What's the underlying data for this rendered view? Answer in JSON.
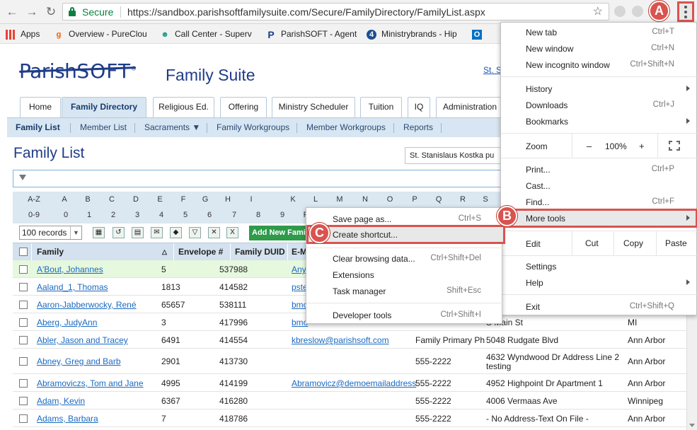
{
  "browser": {
    "secure_label": "Secure",
    "url": "https://sandbox.parishsoftfamilysuite.com/Secure/FamilyDirectory/FamilyList.aspx",
    "bookmarks": [
      {
        "label": "Apps",
        "icon": "apps-grid-icon"
      },
      {
        "label": "Overview - PureClou",
        "icon": "genesys-icon"
      },
      {
        "label": "Call Center - Superv",
        "icon": "person-icon"
      },
      {
        "label": "ParishSOFT - Agent",
        "icon": "parishsoft-p-icon"
      },
      {
        "label": "Ministrybrands - Hip",
        "icon": "ministrybrands-icon"
      },
      {
        "label": "O",
        "icon": "outlook-icon"
      }
    ],
    "badge_count": "4"
  },
  "page": {
    "logo_a": "Parish",
    "logo_b": "SOFT",
    "suite": "Family Suite",
    "parish_link": "St. S",
    "tabs": [
      "Home",
      "Family Directory",
      "Religious Ed.",
      "Offering",
      "Ministry Scheduler",
      "Tuition",
      "IQ",
      "Administration"
    ],
    "subnav": [
      "Family List",
      "Member List",
      "Sacraments ▼",
      "Family Workgroups",
      "Member Workgroups",
      "Reports"
    ],
    "title": "Family List",
    "parish_select": "St. Stanislaus Kostka pu",
    "alpha_row1": [
      "A-Z",
      "A",
      "B",
      "C",
      "D",
      "E",
      "F",
      "G",
      "H",
      "I",
      "K",
      "L",
      "M",
      "N",
      "O",
      "P",
      "Q",
      "R",
      "S"
    ],
    "alpha_row2": [
      "0-9",
      "0",
      "1",
      "2",
      "3",
      "4",
      "5",
      "6",
      "7",
      "8",
      "9",
      "F"
    ],
    "records": "100 records",
    "add_btn": "Add New Family",
    "columns": [
      "Family",
      "Envelope #",
      "Family DUID",
      "E-M"
    ],
    "rows": [
      {
        "name": "A'Bout, Johannes",
        "env": "5",
        "duid": "537988",
        "email": "Any",
        "phone": "",
        "addr": "",
        "city": ""
      },
      {
        "name": "Aaland_1, Thomas",
        "env": "1813",
        "duid": "414582",
        "email": "pste",
        "phone": "",
        "addr": "",
        "city": ""
      },
      {
        "name": "Aaron-Jabberwocky, René",
        "env": "65657",
        "duid": "538111",
        "email": "bmc",
        "phone": "",
        "addr": "",
        "city": ""
      },
      {
        "name": "Aberg, JudyAnn",
        "env": "3",
        "duid": "417996",
        "email": "bmo",
        "phone": "",
        "addr": "S Main St",
        "city": "MI"
      },
      {
        "name": "Abler, Jason and Tracey",
        "env": "6491",
        "duid": "414554",
        "email": "kbreslow@parishsoft.com",
        "phone": "Family Primary Ph",
        "addr": "5048 Rudgate Blvd",
        "city": "Ann Arbor"
      },
      {
        "name": "Abney, Greg and Barb",
        "env": "2901",
        "duid": "413730",
        "email": "",
        "phone": "555-2222",
        "addr": "4632 Wyndwood Dr Address Line 2",
        "addr2": "testing",
        "city": "Ann Arbor"
      },
      {
        "name": "Abramoviczs, Tom and Jane",
        "env": "4995",
        "duid": "414199",
        "email": "Abramovicz@demoemailaddress",
        "phone": "555-2222",
        "addr": "4952 Highpoint Dr Apartment 1",
        "city": "Ann Arbor"
      },
      {
        "name": "Adam, Kevin",
        "env": "6367",
        "duid": "416280",
        "email": "",
        "phone": "555-2222",
        "addr": "4006 Vermaas Ave",
        "city": "Winnipeg"
      },
      {
        "name": "Adams, Barbara",
        "env": "7",
        "duid": "418786",
        "email": "",
        "phone": "555-2222",
        "addr": "- No Address-Text On File -",
        "city": "Ann Arbor"
      }
    ]
  },
  "menu": {
    "items": [
      {
        "label": "New tab",
        "shortcut": "Ctrl+T"
      },
      {
        "label": "New window",
        "shortcut": "Ctrl+N"
      },
      {
        "label": "New incognito window",
        "shortcut": "Ctrl+Shift+N"
      },
      {
        "label": "History",
        "shortcut": ""
      },
      {
        "label": "Downloads",
        "shortcut": "Ctrl+J"
      },
      {
        "label": "Bookmarks",
        "shortcut": ""
      },
      {
        "label": "Print...",
        "shortcut": "Ctrl+P"
      },
      {
        "label": "Cast...",
        "shortcut": ""
      },
      {
        "label": "Find...",
        "shortcut": "Ctrl+F"
      },
      {
        "label": "More tools",
        "shortcut": ""
      },
      {
        "label": "Settings",
        "shortcut": ""
      },
      {
        "label": "Help",
        "shortcut": ""
      },
      {
        "label": "Exit",
        "shortcut": "Ctrl+Shift+Q"
      }
    ],
    "zoom_label": "Zoom",
    "zoom_minus": "–",
    "zoom_value": "100%",
    "zoom_plus": "+",
    "edit_label": "Edit",
    "cut": "Cut",
    "copy": "Copy",
    "paste": "Paste"
  },
  "submenu": {
    "items": [
      {
        "label": "Save page as...",
        "shortcut": "Ctrl+S"
      },
      {
        "label": "Create shortcut...",
        "shortcut": ""
      },
      {
        "label": "Clear browsing data...",
        "shortcut": "Ctrl+Shift+Del"
      },
      {
        "label": "Extensions",
        "shortcut": ""
      },
      {
        "label": "Task manager",
        "shortcut": "Shift+Esc"
      },
      {
        "label": "Developer tools",
        "shortcut": "Ctrl+Shift+I"
      }
    ]
  },
  "callouts": {
    "a": "A",
    "b": "B",
    "c": "C"
  },
  "colors": {
    "accent": "#d9534f",
    "link": "#1a6ac1",
    "brand": "#1f3c88",
    "secure": "#0b8043"
  }
}
